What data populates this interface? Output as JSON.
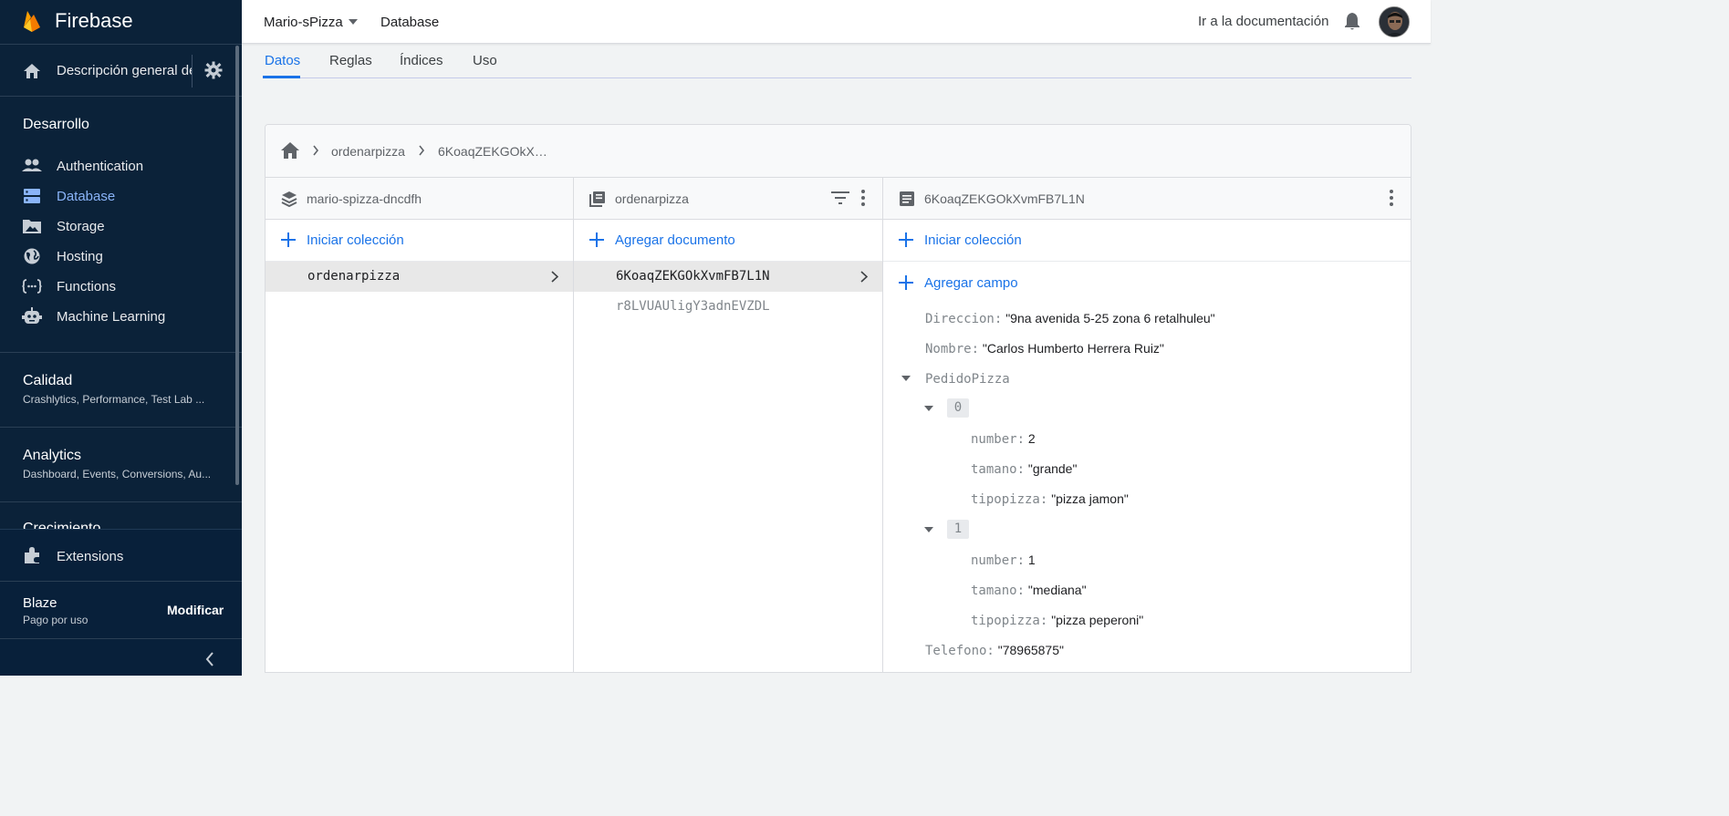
{
  "sidebar": {
    "brand": "Firebase",
    "overview_label": "Descripción general del proyecto",
    "sections": {
      "develop": "Desarrollo",
      "quality": {
        "title": "Calidad",
        "sub": "Crashlytics, Performance, Test Lab ..."
      },
      "analytics": {
        "title": "Analytics",
        "sub": "Dashboard, Events, Conversions, Au..."
      },
      "growth": {
        "title": "Crecimiento"
      }
    },
    "items": [
      {
        "label": "Authentication",
        "icon": "people-icon"
      },
      {
        "label": "Database",
        "icon": "database-icon",
        "active": true
      },
      {
        "label": "Storage",
        "icon": "image-icon"
      },
      {
        "label": "Hosting",
        "icon": "globe-icon"
      },
      {
        "label": "Functions",
        "icon": "functions-icon"
      },
      {
        "label": "Machine Learning",
        "icon": "robot-icon"
      }
    ],
    "extensions_label": "Extensions",
    "plan": {
      "name": "Blaze",
      "sub": "Pago por uso",
      "modify_label": "Modificar"
    }
  },
  "topbar": {
    "project": "Mario-sPizza",
    "breadcrumb": "Database",
    "docs_link": "Ir a la documentación"
  },
  "tabs": [
    "Datos",
    "Reglas",
    "Índices",
    "Uso"
  ],
  "path": {
    "segment1": "ordenarpizza",
    "segment2": "6KoaqZEKGOkX…"
  },
  "columns": {
    "root": {
      "title": "mario-spizza-dncdfh",
      "action": "Iniciar colección",
      "rows": [
        "ordenarpizza"
      ]
    },
    "collection": {
      "title": "ordenarpizza",
      "action": "Agregar documento",
      "rows": [
        "6KoaqZEKGOkXvmFB7L1N",
        "r8LVUAUligY3adnEVZDL"
      ]
    },
    "document": {
      "title": "6KoaqZEKGOkXvmFB7L1N",
      "action_collection": "Iniciar colección",
      "action_field": "Agregar campo",
      "fields": {
        "direccion": {
          "key": "Direccion:",
          "value": "\"9na avenida 5-25 zona 6 retalhuleu\""
        },
        "nombre": {
          "key": "Nombre:",
          "value": "\"Carlos Humberto Herrera Ruiz\""
        },
        "pedido": {
          "key": "PedidoPizza"
        },
        "item0": {
          "index": "0",
          "number": {
            "key": "number:",
            "value": "2"
          },
          "tamano": {
            "key": "tamano:",
            "value": "\"grande\""
          },
          "tipo": {
            "key": "tipopizza:",
            "value": "\"pizza jamon\""
          }
        },
        "item1": {
          "index": "1",
          "number": {
            "key": "number:",
            "value": "1"
          },
          "tamano": {
            "key": "tamano:",
            "value": "\"mediana\""
          },
          "tipo": {
            "key": "tipopizza:",
            "value": "\"pizza peperoni\""
          }
        },
        "telefono": {
          "key": "Telefono:",
          "value": "\"78965875\""
        }
      }
    }
  },
  "colors": {
    "accent": "#1a73e8",
    "sidebar_bg": "#0b2239",
    "active_nav": "#8ab4f8"
  }
}
